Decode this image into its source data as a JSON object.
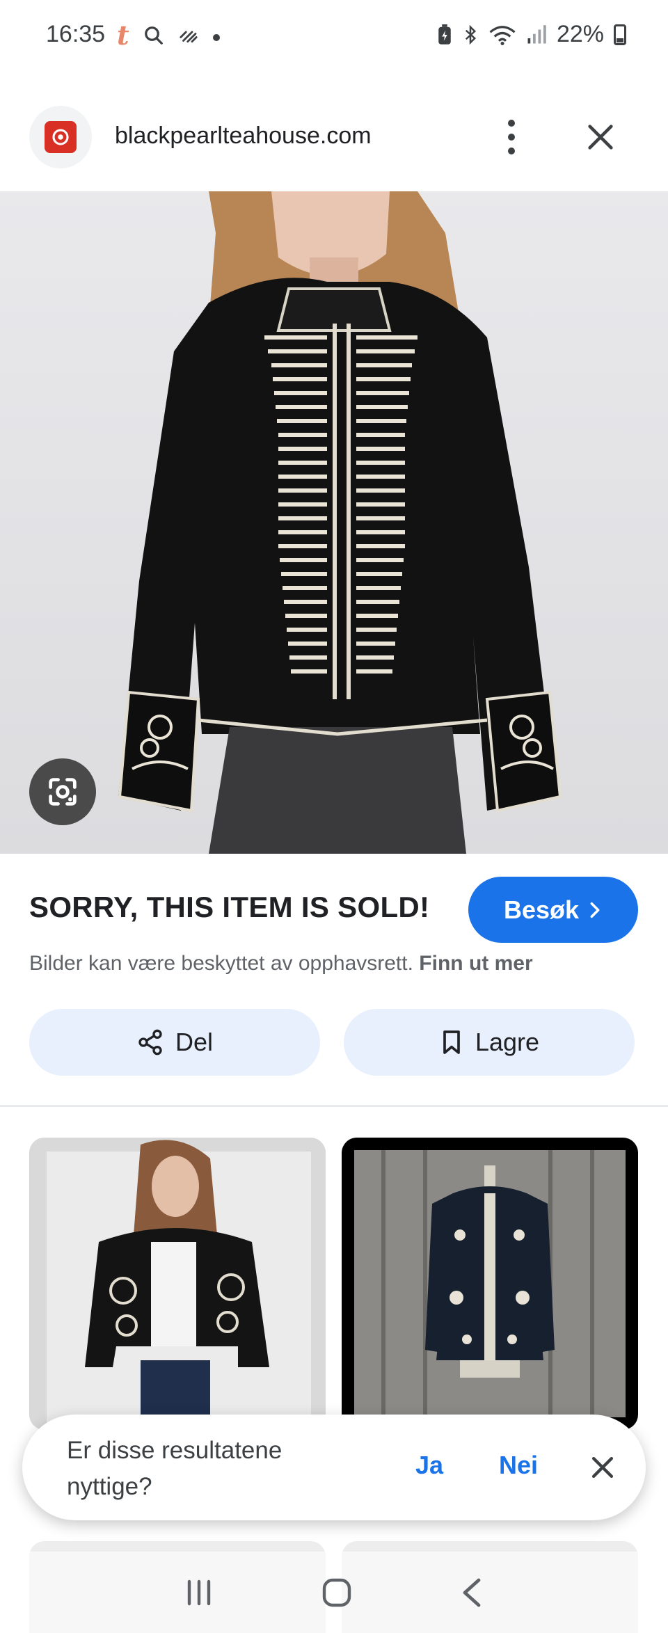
{
  "status_bar": {
    "time": "16:35",
    "left_icons": [
      "t-app-icon",
      "search-icon",
      "activity-icon",
      "notification-dot"
    ],
    "right_icons": [
      "battery-saver-icon",
      "bluetooth-icon",
      "wifi-icon",
      "signal-icon"
    ],
    "battery_percent": "22%"
  },
  "header": {
    "site": "blackpearlteahouse.com",
    "favicon": "site-favicon",
    "menu_icon": "more-vert-icon",
    "close_icon": "close-icon"
  },
  "hero": {
    "lens_icon": "google-lens-icon"
  },
  "info": {
    "title": "SORRY, THIS ITEM IS SOLD!",
    "visit_label": "Besøk",
    "copyright_text": "Bilder kan være beskyttet av opphavsrett.",
    "copyright_link": "Finn ut mer",
    "share_label": "Del",
    "save_label": "Lagre"
  },
  "feedback": {
    "question": "Er disse resultatene nyttige?",
    "yes_label": "Ja",
    "no_label": "Nei"
  },
  "colors": {
    "accent": "#1a73e8",
    "tonal_button": "#e8f0fe",
    "favicon_red": "#d93025"
  }
}
